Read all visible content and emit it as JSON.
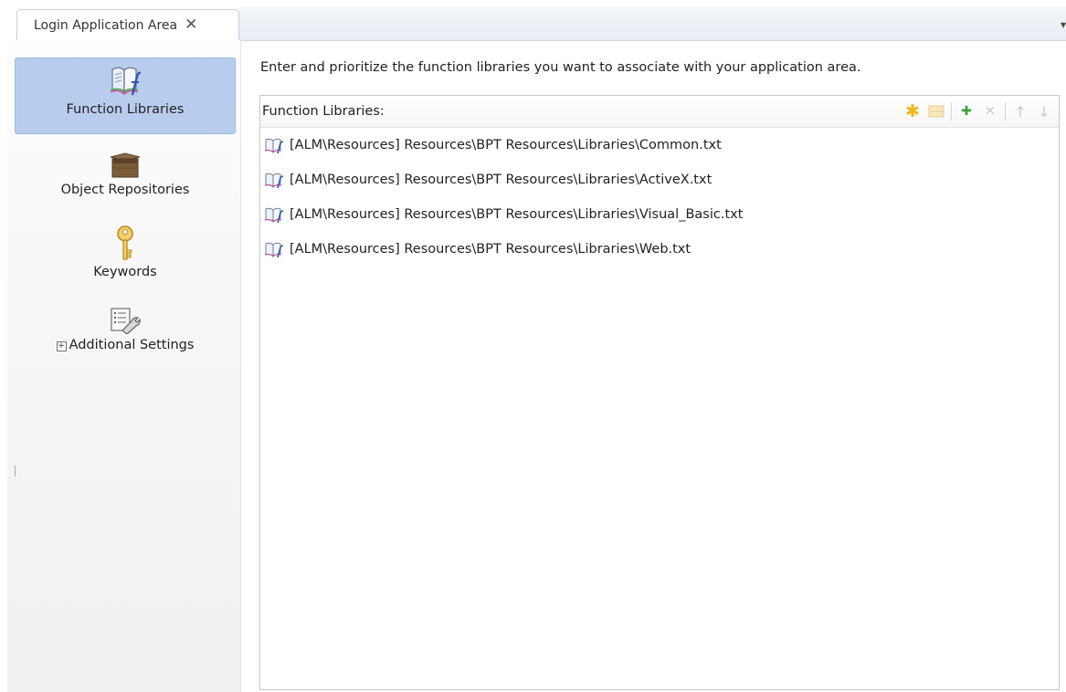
{
  "tab": {
    "title": "Login Application Area",
    "close_glyph": "✕",
    "menu_glyph": "▾"
  },
  "sidebar": {
    "items": [
      {
        "label": "Function Libraries",
        "icon": "function-library-icon",
        "active": true
      },
      {
        "label": "Object Repositories",
        "icon": "box-icon",
        "active": false
      },
      {
        "label": "Keywords",
        "icon": "key-icon",
        "active": false
      },
      {
        "label": "Additional Settings",
        "icon": "settings-list-icon",
        "active": false,
        "expander": "+"
      }
    ]
  },
  "main": {
    "instructions": "Enter and prioritize the function libraries you want to associate with your application area.",
    "panel_title": "Function Libraries:",
    "toolbar": {
      "new": "✱",
      "add": "✚",
      "remove": "✕",
      "up": "↑",
      "down": "↓"
    },
    "libraries": [
      "[ALM\\Resources] Resources\\BPT Resources\\Libraries\\Common.txt",
      "[ALM\\Resources] Resources\\BPT Resources\\Libraries\\ActiveX.txt",
      "[ALM\\Resources] Resources\\BPT Resources\\Libraries\\Visual_Basic.txt",
      "[ALM\\Resources] Resources\\BPT Resources\\Libraries\\Web.txt"
    ]
  },
  "colors": {
    "active_nav": "#b8cdee",
    "accent_new": "#f2b51c",
    "accent_add": "#3aa23a"
  }
}
